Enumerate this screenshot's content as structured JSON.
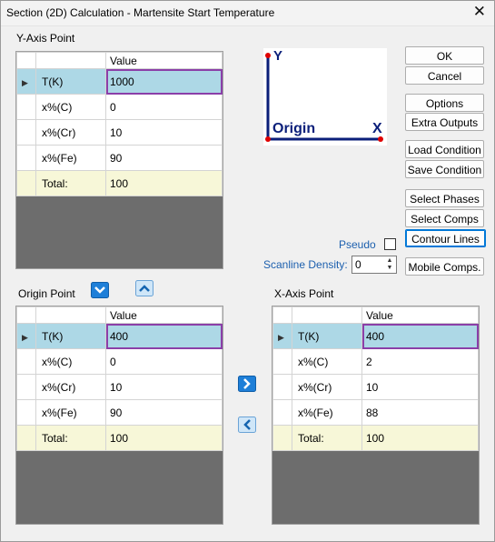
{
  "window": {
    "title": "Section (2D) Calculation - Martensite Start Temperature"
  },
  "y_axis": {
    "heading": "Y-Axis Point",
    "column_header": "Value",
    "rows": [
      {
        "name": "T(K)",
        "value": "1000"
      },
      {
        "name": "x%(C)",
        "value": "0"
      },
      {
        "name": "x%(Cr)",
        "value": "10"
      },
      {
        "name": "x%(Fe)",
        "value": "90"
      }
    ],
    "total_label": "Total:",
    "total_value": "100"
  },
  "origin": {
    "heading": "Origin Point",
    "column_header": "Value",
    "rows": [
      {
        "name": "T(K)",
        "value": "400"
      },
      {
        "name": "x%(C)",
        "value": "0"
      },
      {
        "name": "x%(Cr)",
        "value": "10"
      },
      {
        "name": "x%(Fe)",
        "value": "90"
      }
    ],
    "total_label": "Total:",
    "total_value": "100"
  },
  "x_axis": {
    "heading": "X-Axis Point",
    "column_header": "Value",
    "rows": [
      {
        "name": "T(K)",
        "value": "400"
      },
      {
        "name": "x%(C)",
        "value": "2"
      },
      {
        "name": "x%(Cr)",
        "value": "10"
      },
      {
        "name": "x%(Fe)",
        "value": "88"
      }
    ],
    "total_label": "Total:",
    "total_value": "100"
  },
  "preview": {
    "y_label": "Y",
    "x_label": "X",
    "origin_label": "Origin"
  },
  "buttons": {
    "ok": "OK",
    "cancel": "Cancel",
    "options": "Options",
    "extra_outputs": "Extra Outputs",
    "load_condition": "Load Condition",
    "save_condition": "Save Condition",
    "select_phases": "Select Phases",
    "select_comps": "Select Comps",
    "contour_lines": "Contour Lines",
    "mobile_comps": "Mobile Comps."
  },
  "pseudo": {
    "label": "Pseudo",
    "checked": false
  },
  "scanline": {
    "label": "Scanline Density:",
    "value": "0"
  },
  "colors": {
    "selected_row": "#add8e6",
    "total_row": "#f7f7d8",
    "accent_blue": "#1c5fae",
    "value_outline": "#8b3fa8"
  }
}
